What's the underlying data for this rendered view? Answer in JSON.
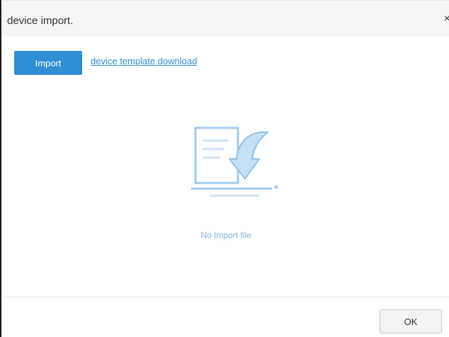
{
  "dialog": {
    "title": "device import.",
    "close_glyph": "×"
  },
  "toolbar": {
    "import_label": "Import",
    "template_link": "device template download"
  },
  "empty_state": {
    "icon": "import-file-icon",
    "message": "No Import file"
  },
  "footer": {
    "ok_label": "OK"
  },
  "colors": {
    "primary": "#2f8ed4",
    "illustration": "#9fcbef",
    "title_bg": "#f5f5f5"
  }
}
